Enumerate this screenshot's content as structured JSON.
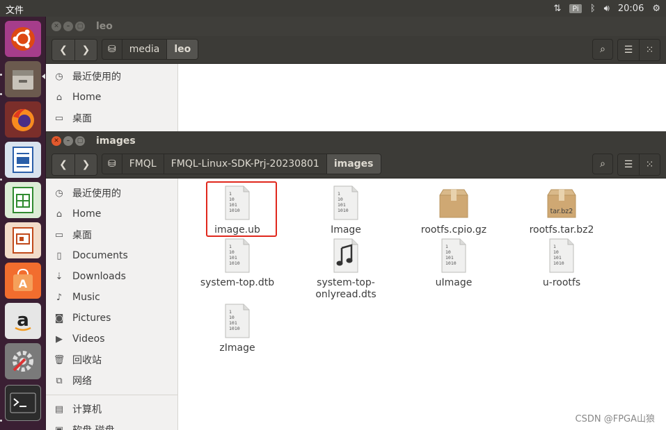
{
  "topbar": {
    "app_name": "文件",
    "keyboard": "Pi",
    "time": "20:06"
  },
  "back_window": {
    "title": "leo",
    "breadcrumbs": [
      "media",
      "leo"
    ],
    "sidebar": [
      "最近使用的",
      "Home",
      "桌面"
    ]
  },
  "front_window": {
    "title": "images",
    "breadcrumbs": [
      "FMQL",
      "FMQL-Linux-SDK-Prj-20230801",
      "images"
    ],
    "sidebar": {
      "recent": "最近使用的",
      "home": "Home",
      "desktop": "桌面",
      "documents": "Documents",
      "downloads": "Downloads",
      "music": "Music",
      "pictures": "Pictures",
      "videos": "Videos",
      "trash": "回收站",
      "network": "网络",
      "computer": "计算机",
      "floppy": "软盘 磁盘"
    },
    "files": [
      {
        "name": "image.ub",
        "icon": "binary-file-icon"
      },
      {
        "name": "Image",
        "icon": "binary-file-icon"
      },
      {
        "name": "rootfs.cpio.gz",
        "icon": "archive-icon"
      },
      {
        "name": "rootfs.tar.bz2",
        "icon": "archive-icon",
        "badge": "tar.bz2"
      },
      {
        "name": "system-top.dtb",
        "icon": "binary-file-icon"
      },
      {
        "name": "system-top-onlyread.dts",
        "icon": "audio-file-icon"
      },
      {
        "name": "uImage",
        "icon": "binary-file-icon"
      },
      {
        "name": "u-rootfs",
        "icon": "binary-file-icon"
      },
      {
        "name": "zImage",
        "icon": "binary-file-icon"
      }
    ],
    "bin_glyph": [
      "1",
      "10",
      "101",
      "1010"
    ]
  },
  "colors": {
    "selection": "#e0271c",
    "launcher": "#3a1f33",
    "titlebar": "#3c3b37"
  },
  "watermark": "CSDN @FPGA山狼"
}
